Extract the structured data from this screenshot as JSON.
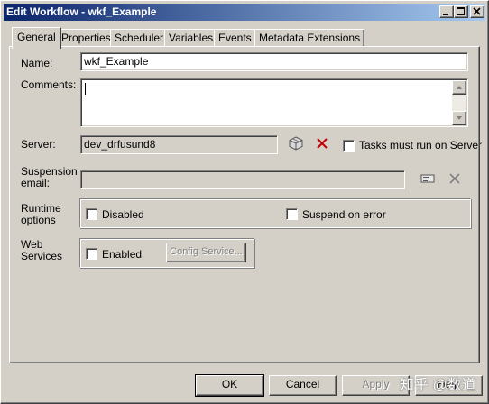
{
  "window": {
    "title": "Edit Workflow - wkf_Example"
  },
  "tabs": [
    {
      "label": "General",
      "active": true
    },
    {
      "label": "Properties"
    },
    {
      "label": "Scheduler"
    },
    {
      "label": "Variables"
    },
    {
      "label": "Events"
    },
    {
      "label": "Metadata Extensions"
    }
  ],
  "general": {
    "name_label": "Name:",
    "name_value": "wkf_Example",
    "comments_label": "Comments:",
    "comments_value": "",
    "server_label": "Server:",
    "server_value": "dev_drfusund8",
    "tasks_must_run_label": "Tasks must run on Server",
    "tasks_must_run_checked": false,
    "suspension_label_line1": "Suspension",
    "suspension_label_line2": "email:",
    "suspension_value": "",
    "runtime_label_line1": "Runtime",
    "runtime_label_line2": "options",
    "disabled_label": "Disabled",
    "disabled_checked": false,
    "suspend_on_error_label": "Suspend on error",
    "suspend_on_error_checked": false,
    "web_label_line1": "Web",
    "web_label_line2": "Services",
    "enabled_label": "Enabled",
    "enabled_checked": false,
    "config_service_label": "Config Service..."
  },
  "footer": {
    "ok_label": "OK",
    "cancel_label": "Cancel",
    "apply_label": "Apply",
    "help_label": "Help"
  },
  "watermark": "知乎 @数道",
  "icons": {
    "minimize": "minimize-icon",
    "maximize": "maximize-icon",
    "close": "close-icon",
    "server_browse": "package-browse-icon",
    "server_clear": "red-x-delete-icon",
    "email_browse": "email-browse-icon",
    "email_clear": "gray-x-delete-icon"
  },
  "colors": {
    "title_start": "#0a246a",
    "title_end": "#a6caf0",
    "face": "#d4d0c8",
    "delete_red": "#c00000"
  }
}
